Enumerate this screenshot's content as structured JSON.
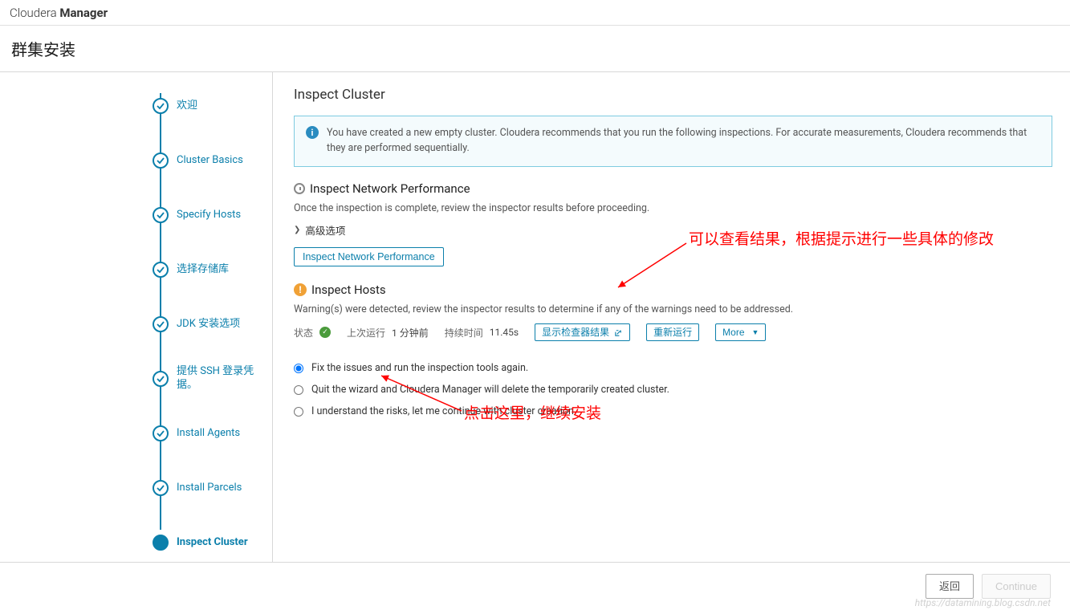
{
  "brand": {
    "light": "Cloudera ",
    "bold": "Manager"
  },
  "page_title": "群集安装",
  "steps": [
    {
      "label": "欢迎",
      "done": true
    },
    {
      "label": "Cluster Basics",
      "done": true
    },
    {
      "label": "Specify Hosts",
      "done": true
    },
    {
      "label": "选择存储库",
      "done": true
    },
    {
      "label": "JDK 安装选项",
      "done": true
    },
    {
      "label": "提供 SSH 登录凭 据。",
      "done": true
    },
    {
      "label": "Install Agents",
      "done": true
    },
    {
      "label": "Install Parcels",
      "done": true
    },
    {
      "label": "Inspect Cluster",
      "current": true
    }
  ],
  "main": {
    "title": "Inspect Cluster",
    "info_banner": "You have created a new empty cluster. Cloudera recommends that you run the following inspections. For accurate measurements, Cloudera recommends that they are performed sequentially.",
    "net_section_title": "Inspect Network Performance",
    "net_desc": "Once the inspection is complete, review the inspector results before proceeding.",
    "adv_options": "高级选项",
    "inspect_net_btn": "Inspect Network Performance",
    "hosts_title": "Inspect Hosts",
    "hosts_desc": "Warning(s) were detected, review the inspector results to determine if any of the warnings need to be addressed.",
    "status_label": "状态",
    "last_run_label": "上次运行",
    "last_run_value": "1 分钟前",
    "duration_label": "持续时间",
    "duration_value": "11.45s",
    "show_results_btn": "显示检查器结果",
    "rerun_btn": "重新运行",
    "more_btn": "More",
    "radios": {
      "fix": "Fix the issues and run the inspection tools again.",
      "quit": "Quit the wizard and Cloudera Manager will delete the temporarily created cluster.",
      "understand": "I understand the risks, let me continue with cluster creation."
    }
  },
  "footer": {
    "back": "返回",
    "continue": "Continue"
  },
  "watermark": "https://datamining.blog.csdn.net",
  "annotations": {
    "text1": "可以查看结果，根据提示进行一些具体的修改",
    "text2": "点击这里，继续安装"
  }
}
